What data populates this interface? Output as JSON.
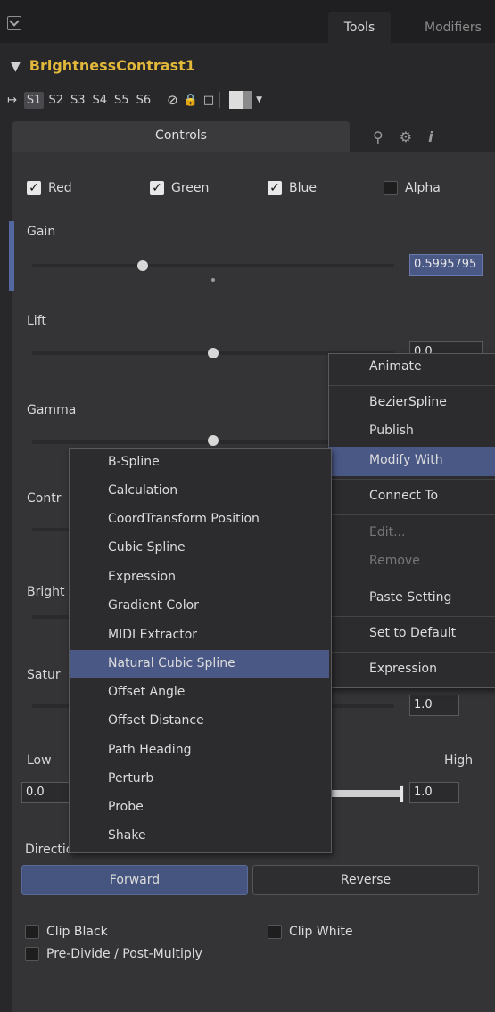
{
  "header": {
    "expand_icon": "collapse-box-icon",
    "tabs": [
      {
        "label": "Tools"
      },
      {
        "label": "Modifiers"
      }
    ]
  },
  "tool": {
    "name": "BrightnessContrast1",
    "versions": [
      "S1",
      "S2",
      "S3",
      "S4",
      "S5",
      "S6"
    ],
    "active_version": "S1"
  },
  "inspector_tabs": {
    "controls_label": "Controls",
    "icons": [
      "modifiers-icon",
      "settings-gear-icon",
      "info-icon"
    ]
  },
  "channels": [
    {
      "label": "Red",
      "checked": true
    },
    {
      "label": "Green",
      "checked": true
    },
    {
      "label": "Blue",
      "checked": true
    },
    {
      "label": "Alpha",
      "checked": false
    }
  ],
  "controls": {
    "gain_label": "Gain",
    "gain_value": "0.5995795",
    "lift_label": "Lift",
    "lift_value": "0.0",
    "gamma_label": "Gamma",
    "contrast_label": "Contr",
    "brightness_label": "Bright",
    "saturation_label": "Satur",
    "saturation_value": "1.0",
    "low_label": "Low",
    "high_label": "High",
    "low_value": "0.0",
    "high_value": "1.0",
    "direction_label": "Direction",
    "forward_label": "Forward",
    "reverse_label": "Reverse",
    "clip_black": {
      "label": "Clip Black",
      "checked": false
    },
    "clip_white": {
      "label": "Clip White",
      "checked": false
    },
    "predivide": {
      "label": "Pre-Divide / Post-Multiply",
      "checked": false
    }
  },
  "context_menu": {
    "items": [
      {
        "label": "Animate",
        "enabled": true
      },
      {
        "label": "BezierSpline",
        "enabled": true
      },
      {
        "label": "Publish",
        "enabled": true
      },
      {
        "label": "Modify With",
        "enabled": true,
        "highlighted": true
      },
      {
        "label": "Connect To",
        "enabled": true
      },
      {
        "label": "Edit...",
        "enabled": false
      },
      {
        "label": "Remove",
        "enabled": false
      },
      {
        "label": "Paste Setting",
        "enabled": true
      },
      {
        "label": "Set to Default",
        "enabled": true
      },
      {
        "label": "Expression",
        "enabled": true
      }
    ]
  },
  "modify_with_menu": {
    "items": [
      {
        "label": "B-Spline"
      },
      {
        "label": "Calculation"
      },
      {
        "label": "CoordTransform Position"
      },
      {
        "label": "Cubic Spline"
      },
      {
        "label": "Expression"
      },
      {
        "label": "Gradient Color"
      },
      {
        "label": "MIDI Extractor"
      },
      {
        "label": "Natural Cubic Spline",
        "highlighted": true
      },
      {
        "label": "Offset Angle"
      },
      {
        "label": "Offset Distance"
      },
      {
        "label": "Path Heading"
      },
      {
        "label": "Perturb"
      },
      {
        "label": "Probe"
      },
      {
        "label": "Shake"
      }
    ]
  },
  "colors": {
    "accent_blue": "#4a5886",
    "tool_name": "#e2b83b",
    "panel": "#343437"
  }
}
